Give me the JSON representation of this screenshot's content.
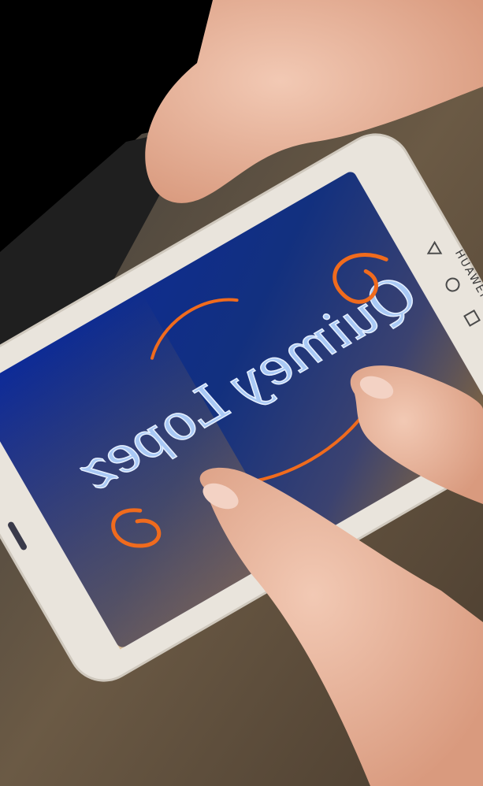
{
  "photo": {
    "subject": "hands-holding-phone",
    "phone_brand_text": "HUAWEI",
    "screen_text_mirrored": "Quimey Lopez",
    "colors": {
      "screen_blue": "#14309a",
      "lettering_blue": "#a9c9f5",
      "flourish_orange": "#f06b1d",
      "phone_body": "#e9e4dc",
      "skin": "#e9b9a0",
      "table": "#5a4a3a",
      "fabric": "#222222"
    },
    "nav_icons": [
      "back-triangle-icon",
      "home-circle-icon",
      "recent-square-icon"
    ]
  }
}
